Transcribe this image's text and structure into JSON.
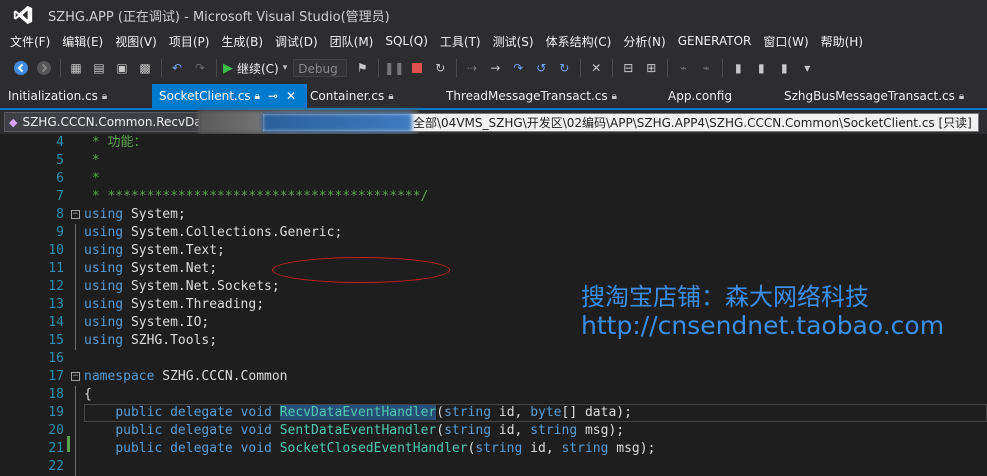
{
  "window": {
    "title": "SZHG.APP (正在调试) - Microsoft Visual Studio(管理员)"
  },
  "menu": [
    "文件(F)",
    "编辑(E)",
    "视图(V)",
    "项目(P)",
    "生成(B)",
    "调试(D)",
    "团队(M)",
    "SQL(Q)",
    "工具(T)",
    "测试(S)",
    "体系结构(C)",
    "分析(N)",
    "GENERATOR",
    "窗口(W)",
    "帮助(H)"
  ],
  "toolbar": {
    "continue_label": "继续(C)",
    "config_value": "Debug"
  },
  "tabs": [
    {
      "label": "Initialization.cs",
      "active": false
    },
    {
      "label": "SocketClient.cs",
      "active": true
    },
    {
      "label": "Container.cs",
      "active": false
    },
    {
      "label": "ThreadMessageTransact.cs",
      "active": false
    },
    {
      "label": "App.config",
      "active": false
    },
    {
      "label": "SzhgBusMessageTransact.cs",
      "active": false
    }
  ],
  "nav": {
    "class_combo": "SZHG.CCCN.Common.RecvDa",
    "path_tooltip": "全部\\04VMS_SZHG\\开发区\\02编码\\APP\\SZHG.APP4\\SZHG.CCCN.Common\\SocketClient.cs [只读]"
  },
  "code_lines": [
    {
      "n": "4",
      "fold": "",
      "segs": [
        {
          "t": " * 功能：",
          "c": "cm"
        }
      ]
    },
    {
      "n": "5",
      "fold": "",
      "segs": [
        {
          "t": " *",
          "c": "cm"
        }
      ]
    },
    {
      "n": "6",
      "fold": "",
      "segs": [
        {
          "t": " *",
          "c": "cm"
        }
      ]
    },
    {
      "n": "7",
      "fold": "",
      "segs": [
        {
          "t": " * ****************************************/",
          "c": "cm"
        }
      ]
    },
    {
      "n": "8",
      "fold": "minus",
      "segs": [
        {
          "t": "using",
          "c": "kw"
        },
        {
          "t": " System;",
          "c": "tx"
        }
      ]
    },
    {
      "n": "9",
      "fold": "line",
      "segs": [
        {
          "t": "using",
          "c": "kw"
        },
        {
          "t": " System.Collections.Generic;",
          "c": "tx"
        }
      ]
    },
    {
      "n": "10",
      "fold": "line",
      "segs": [
        {
          "t": "using",
          "c": "kw"
        },
        {
          "t": " System.Text;",
          "c": "tx"
        }
      ]
    },
    {
      "n": "11",
      "fold": "line",
      "segs": [
        {
          "t": "using",
          "c": "kw"
        },
        {
          "t": " System.Net;",
          "c": "tx"
        }
      ]
    },
    {
      "n": "12",
      "fold": "line",
      "segs": [
        {
          "t": "using",
          "c": "kw"
        },
        {
          "t": " System.Net.Sockets;",
          "c": "tx"
        }
      ]
    },
    {
      "n": "13",
      "fold": "line",
      "segs": [
        {
          "t": "using",
          "c": "kw"
        },
        {
          "t": " System.Threading;",
          "c": "tx"
        }
      ]
    },
    {
      "n": "14",
      "fold": "line",
      "segs": [
        {
          "t": "using",
          "c": "kw"
        },
        {
          "t": " System.IO;",
          "c": "tx"
        }
      ]
    },
    {
      "n": "15",
      "fold": "line",
      "segs": [
        {
          "t": "using",
          "c": "kw"
        },
        {
          "t": " SZHG.Tools;",
          "c": "tx"
        }
      ]
    },
    {
      "n": "16",
      "fold": "",
      "segs": [
        {
          "t": "",
          "c": "tx"
        }
      ]
    },
    {
      "n": "17",
      "fold": "minus",
      "segs": [
        {
          "t": "namespace",
          "c": "kw"
        },
        {
          "t": " SZHG.CCCN.Common",
          "c": "tx"
        }
      ]
    },
    {
      "n": "18",
      "fold": "line",
      "segs": [
        {
          "t": "{",
          "c": "tx"
        }
      ]
    },
    {
      "n": "19",
      "fold": "line",
      "current": true,
      "segs": [
        {
          "t": "    ",
          "c": "tx"
        },
        {
          "t": "public",
          "c": "kw"
        },
        {
          "t": " ",
          "c": "tx"
        },
        {
          "t": "delegate",
          "c": "kw"
        },
        {
          "t": " ",
          "c": "tx"
        },
        {
          "t": "void",
          "c": "kw"
        },
        {
          "t": " ",
          "c": "tx"
        },
        {
          "t": "RecvDataEventHandler",
          "c": "ty hl"
        },
        {
          "t": "(",
          "c": "tx"
        },
        {
          "t": "string",
          "c": "kw"
        },
        {
          "t": " id, ",
          "c": "tx"
        },
        {
          "t": "byte",
          "c": "kw"
        },
        {
          "t": "[] data);",
          "c": "tx"
        }
      ]
    },
    {
      "n": "20",
      "fold": "line",
      "segs": [
        {
          "t": "    ",
          "c": "tx"
        },
        {
          "t": "public",
          "c": "kw"
        },
        {
          "t": " ",
          "c": "tx"
        },
        {
          "t": "delegate",
          "c": "kw"
        },
        {
          "t": " ",
          "c": "tx"
        },
        {
          "t": "void",
          "c": "kw"
        },
        {
          "t": " ",
          "c": "tx"
        },
        {
          "t": "SentDataEventHandler",
          "c": "ty"
        },
        {
          "t": "(",
          "c": "tx"
        },
        {
          "t": "string",
          "c": "kw"
        },
        {
          "t": " id, ",
          "c": "tx"
        },
        {
          "t": "string",
          "c": "kw"
        },
        {
          "t": " msg);",
          "c": "tx"
        }
      ]
    },
    {
      "n": "21",
      "fold": "line",
      "segs": [
        {
          "t": "    ",
          "c": "tx"
        },
        {
          "t": "public",
          "c": "kw"
        },
        {
          "t": " ",
          "c": "tx"
        },
        {
          "t": "delegate",
          "c": "kw"
        },
        {
          "t": " ",
          "c": "tx"
        },
        {
          "t": "void",
          "c": "kw"
        },
        {
          "t": " ",
          "c": "tx"
        },
        {
          "t": "SocketClosedEventHandler",
          "c": "ty"
        },
        {
          "t": "(",
          "c": "tx"
        },
        {
          "t": "string",
          "c": "kw"
        },
        {
          "t": " id, ",
          "c": "tx"
        },
        {
          "t": "string",
          "c": "kw"
        },
        {
          "t": " msg);",
          "c": "tx"
        }
      ]
    },
    {
      "n": "22",
      "fold": "line",
      "segs": [
        {
          "t": "",
          "c": "tx"
        }
      ]
    }
  ],
  "watermark": {
    "line1": "搜淘宝店铺：森大网络科技",
    "line2": "http://cnsendnet.taobao.com"
  },
  "colors": {
    "accent": "#007acc",
    "keyword": "#569cd6",
    "type": "#4ec9b0",
    "comment": "#57a64a",
    "line_number": "#2b91af"
  }
}
